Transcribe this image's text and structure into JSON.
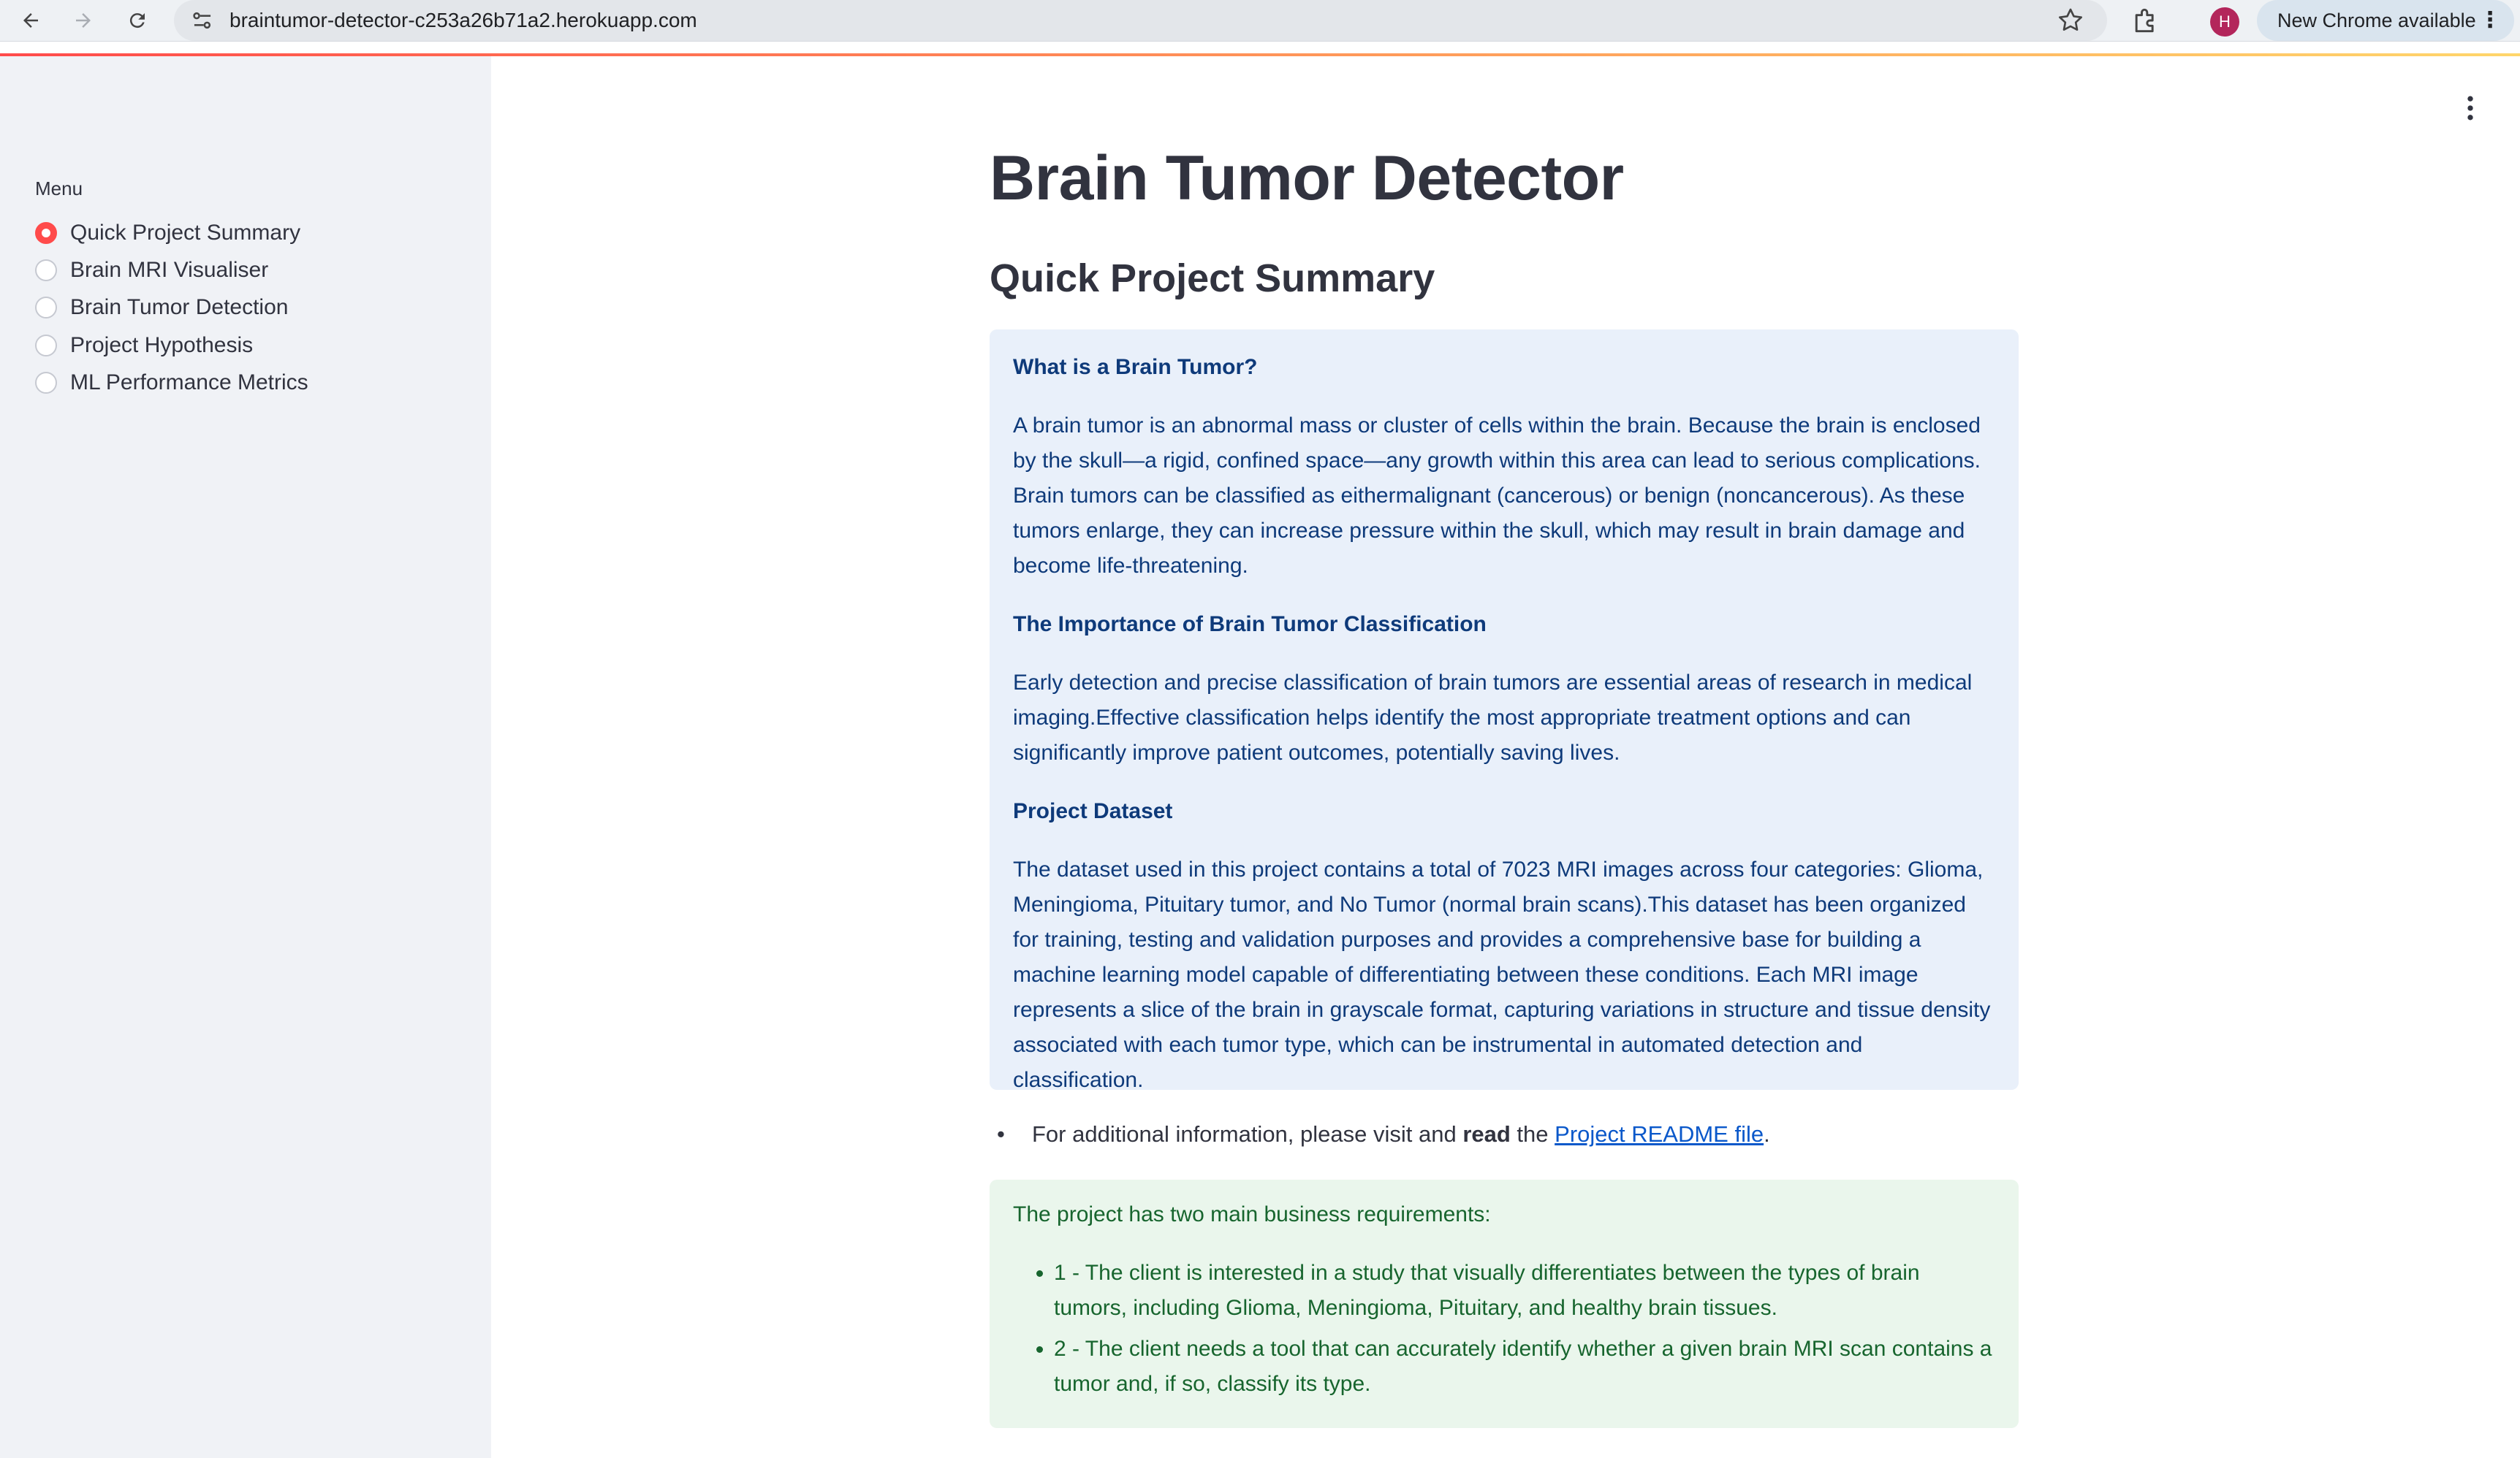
{
  "browser": {
    "url": "braintumor-detector-c253a26b71a2.herokuapp.com",
    "profile_initial": "H",
    "update_label": "New Chrome available"
  },
  "sidebar": {
    "menu_label": "Menu",
    "items": [
      {
        "label": "Quick Project Summary",
        "selected": true
      },
      {
        "label": "Brain MRI Visualiser",
        "selected": false
      },
      {
        "label": "Brain Tumor Detection",
        "selected": false
      },
      {
        "label": "Project Hypothesis",
        "selected": false
      },
      {
        "label": "ML Performance Metrics",
        "selected": false
      }
    ]
  },
  "main": {
    "title": "Brain Tumor Detector",
    "section_title": "Quick Project Summary",
    "info": {
      "heading1": "What is a Brain Tumor?",
      "para1": "A brain tumor is an abnormal mass or cluster of cells within the brain. Because the brain is enclosed by the skull—a rigid, confined space—any growth within this area can lead to serious complications. Brain tumors can be classified as eithermalignant (cancerous) or benign (noncancerous). As these tumors enlarge, they can increase pressure within the skull, which may result in brain damage and become life-threatening.",
      "heading2": "The Importance of Brain Tumor Classification",
      "para2": "Early detection and precise classification of brain tumors are essential areas of research in medical imaging.Effective classification helps identify the most appropriate treatment options and can significantly improve patient outcomes, potentially saving lives.",
      "heading3": "Project Dataset",
      "para3": "The dataset used in this project contains a total of 7023 MRI images across four categories: Glioma, Meningioma, Pituitary tumor, and No Tumor (normal brain scans).This dataset has been organized for training, testing and validation purposes and provides a comprehensive base for building a machine learning model capable of differentiating between these conditions. Each MRI image represents a slice of the brain in grayscale format, capturing variations in structure and tissue density associated with each tumor type, which can be instrumental in automated detection and classification."
    },
    "readme_line": {
      "before": "For additional information, please visit and ",
      "bold": "read",
      "middle": " the ",
      "link": "Project README file",
      "after": "."
    },
    "requirements": {
      "intro": "The project has two main business requirements:",
      "items": [
        "1 - The client is interested in a study that visually differentiates between the types of brain tumors, including Glioma, Meningioma, Pituitary, and healthy brain tissues.",
        "2 - The client needs a tool that can accurately identify whether a given brain MRI scan contains a tumor and, if so, classify its type."
      ]
    }
  }
}
